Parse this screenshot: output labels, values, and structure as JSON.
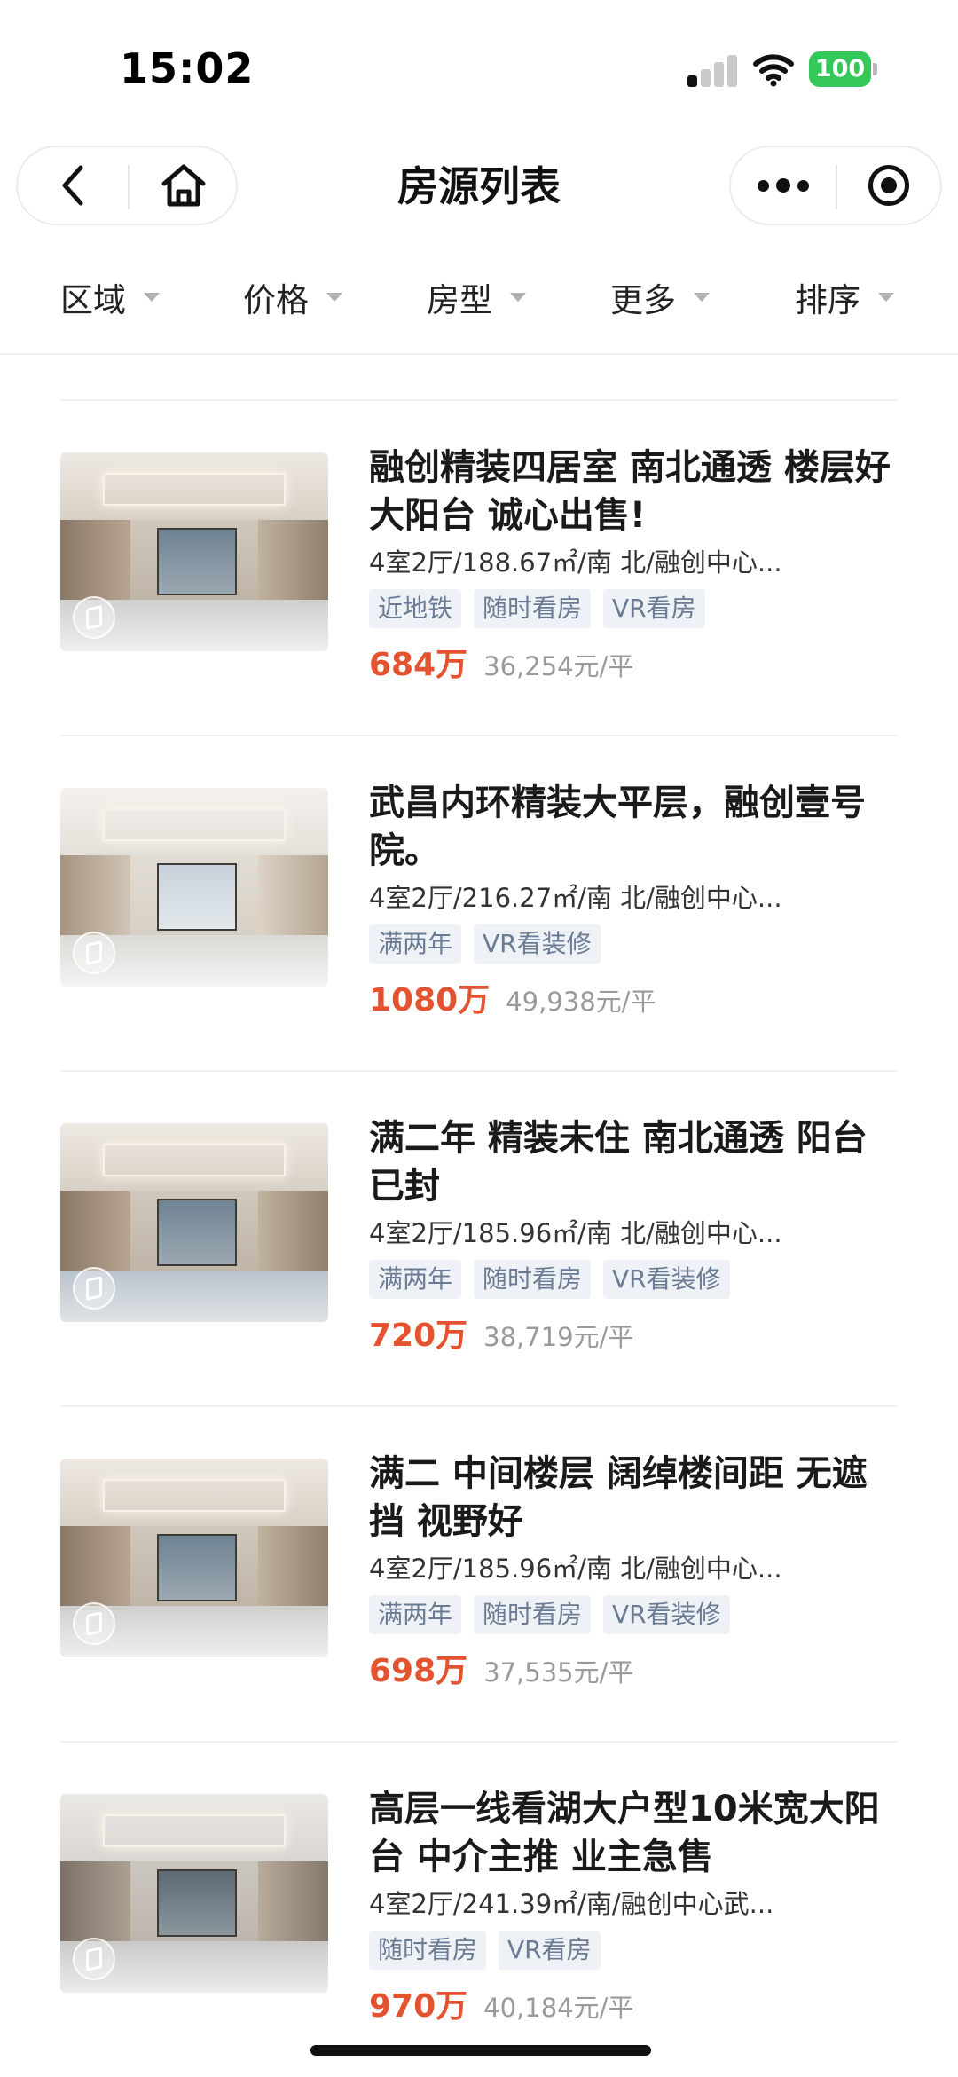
{
  "status_bar": {
    "time": "15:02",
    "battery": "100"
  },
  "nav": {
    "title": "房源列表"
  },
  "filters": [
    "区域",
    "价格",
    "房型",
    "更多",
    "排序"
  ],
  "listings": [
    {
      "title": "融创精装四居室 南北通透 楼层好 大阳台 诚心出售!",
      "meta": "4室2厅/188.67㎡/南 北/融创中心...",
      "tags": [
        "近地铁",
        "随时看房",
        "VR看房"
      ],
      "price": "684万",
      "unit_price": "36,254元/平"
    },
    {
      "title": "武昌内环精装大平层，融创壹号院。",
      "meta": "4室2厅/216.27㎡/南 北/融创中心...",
      "tags": [
        "满两年",
        "VR看装修"
      ],
      "price": "1080万",
      "unit_price": "49,938元/平"
    },
    {
      "title": "满二年 精装未住 南北通透 阳台已封",
      "meta": "4室2厅/185.96㎡/南 北/融创中心...",
      "tags": [
        "满两年",
        "随时看房",
        "VR看装修"
      ],
      "price": "720万",
      "unit_price": "38,719元/平"
    },
    {
      "title": "满二 中间楼层 阔绰楼间距 无遮挡 视野好",
      "meta": "4室2厅/185.96㎡/南 北/融创中心...",
      "tags": [
        "满两年",
        "随时看房",
        "VR看装修"
      ],
      "price": "698万",
      "unit_price": "37,535元/平"
    },
    {
      "title": "高层一线看湖大户型10米宽大阳台 中介主推 业主急售",
      "meta": "4室2厅/241.39㎡/南/融创中心武...",
      "tags": [
        "随时看房",
        "VR看房"
      ],
      "price": "970万",
      "unit_price": "40,184元/平"
    }
  ],
  "colors": {
    "price": "#e4532f",
    "tag_bg": "#eef1f6",
    "tag_text": "#6a7b93",
    "battery": "#34c759"
  }
}
